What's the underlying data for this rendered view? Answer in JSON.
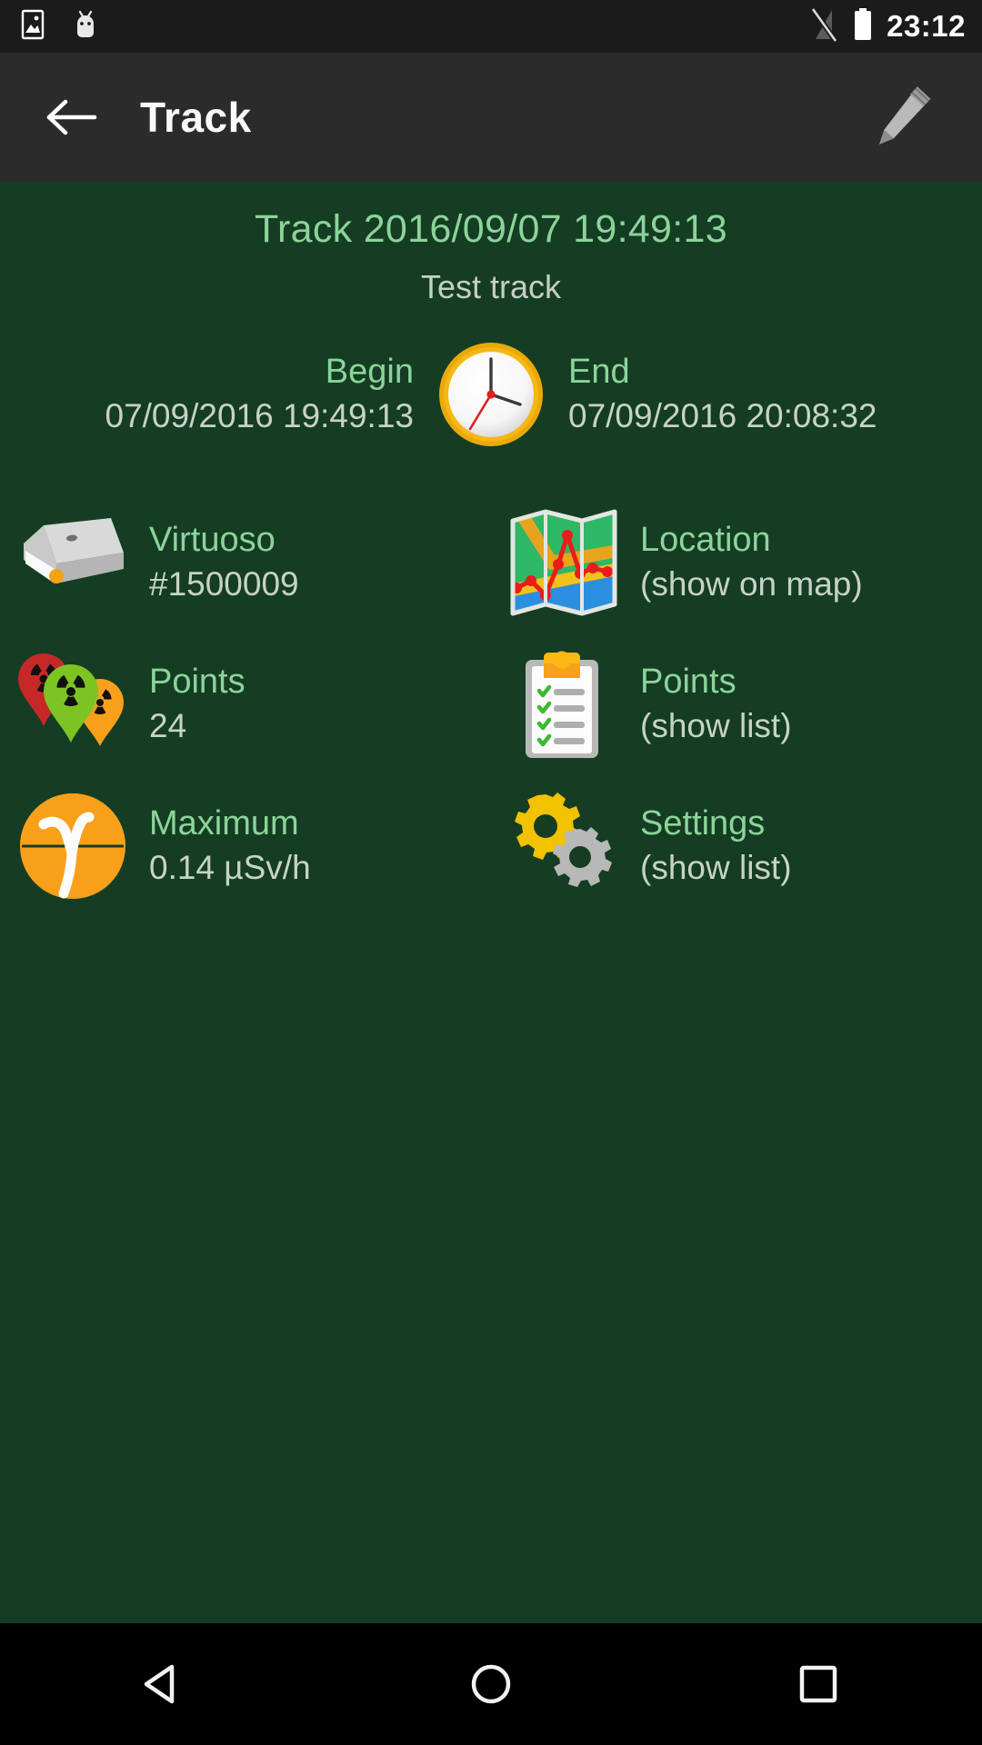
{
  "statusbar": {
    "icons": [
      "image-icon",
      "android-head-icon",
      "signal-off-icon",
      "battery-full-icon"
    ],
    "time": "23:12"
  },
  "appbar": {
    "back_label": "back-arrow",
    "title": "Track",
    "edit_label": "edit-pencil"
  },
  "track": {
    "title": "Track 2016/09/07 19:49:13",
    "subtitle": "Test track",
    "begin": {
      "label": "Begin",
      "value": "07/09/2016 19:49:13"
    },
    "end": {
      "label": "End",
      "value": "07/09/2016 20:08:32"
    },
    "clock_icon": "analog-clock-icon"
  },
  "items": [
    {
      "icon": "device-box-icon",
      "label": "Virtuoso",
      "value": "#1500009"
    },
    {
      "icon": "folded-map-icon",
      "label": "Location",
      "value": "(show on map)"
    },
    {
      "icon": "radiation-markers-icon",
      "label": "Points",
      "value": "24"
    },
    {
      "icon": "clipboard-checklist-icon",
      "label": "Points",
      "value": "(show list)"
    },
    {
      "icon": "gamma-radiation-icon",
      "label": "Maximum",
      "value": "0.14 µSv/h"
    },
    {
      "icon": "gears-icon",
      "label": "Settings",
      "value": "(show list)"
    }
  ],
  "navbar": {
    "back": "nav-back-triangle",
    "home": "nav-home-circle",
    "recents": "nav-recents-square"
  },
  "colors": {
    "background": "#153d23",
    "appbar": "#2b2b2b",
    "statusbar": "#1b1b1b",
    "label_green": "#8cd49a",
    "value_grey": "#c7d2c9",
    "accent_orange": "#f9a01b"
  }
}
